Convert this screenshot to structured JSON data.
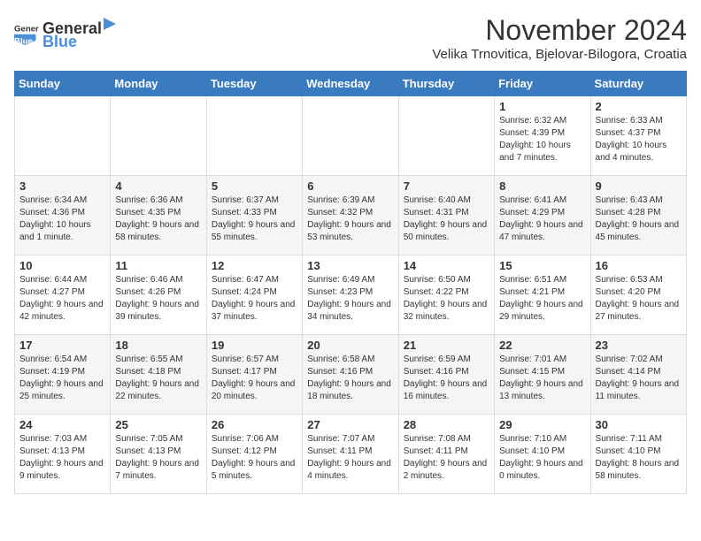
{
  "logo": {
    "general": "General",
    "blue": "Blue"
  },
  "title": "November 2024",
  "subtitle": "Velika Trnovitica, Bjelovar-Bilogora, Croatia",
  "days_of_week": [
    "Sunday",
    "Monday",
    "Tuesday",
    "Wednesday",
    "Thursday",
    "Friday",
    "Saturday"
  ],
  "weeks": [
    [
      {
        "day": "",
        "info": ""
      },
      {
        "day": "",
        "info": ""
      },
      {
        "day": "",
        "info": ""
      },
      {
        "day": "",
        "info": ""
      },
      {
        "day": "",
        "info": ""
      },
      {
        "day": "1",
        "info": "Sunrise: 6:32 AM\nSunset: 4:39 PM\nDaylight: 10 hours and 7 minutes."
      },
      {
        "day": "2",
        "info": "Sunrise: 6:33 AM\nSunset: 4:37 PM\nDaylight: 10 hours and 4 minutes."
      }
    ],
    [
      {
        "day": "3",
        "info": "Sunrise: 6:34 AM\nSunset: 4:36 PM\nDaylight: 10 hours and 1 minute."
      },
      {
        "day": "4",
        "info": "Sunrise: 6:36 AM\nSunset: 4:35 PM\nDaylight: 9 hours and 58 minutes."
      },
      {
        "day": "5",
        "info": "Sunrise: 6:37 AM\nSunset: 4:33 PM\nDaylight: 9 hours and 55 minutes."
      },
      {
        "day": "6",
        "info": "Sunrise: 6:39 AM\nSunset: 4:32 PM\nDaylight: 9 hours and 53 minutes."
      },
      {
        "day": "7",
        "info": "Sunrise: 6:40 AM\nSunset: 4:31 PM\nDaylight: 9 hours and 50 minutes."
      },
      {
        "day": "8",
        "info": "Sunrise: 6:41 AM\nSunset: 4:29 PM\nDaylight: 9 hours and 47 minutes."
      },
      {
        "day": "9",
        "info": "Sunrise: 6:43 AM\nSunset: 4:28 PM\nDaylight: 9 hours and 45 minutes."
      }
    ],
    [
      {
        "day": "10",
        "info": "Sunrise: 6:44 AM\nSunset: 4:27 PM\nDaylight: 9 hours and 42 minutes."
      },
      {
        "day": "11",
        "info": "Sunrise: 6:46 AM\nSunset: 4:26 PM\nDaylight: 9 hours and 39 minutes."
      },
      {
        "day": "12",
        "info": "Sunrise: 6:47 AM\nSunset: 4:24 PM\nDaylight: 9 hours and 37 minutes."
      },
      {
        "day": "13",
        "info": "Sunrise: 6:49 AM\nSunset: 4:23 PM\nDaylight: 9 hours and 34 minutes."
      },
      {
        "day": "14",
        "info": "Sunrise: 6:50 AM\nSunset: 4:22 PM\nDaylight: 9 hours and 32 minutes."
      },
      {
        "day": "15",
        "info": "Sunrise: 6:51 AM\nSunset: 4:21 PM\nDaylight: 9 hours and 29 minutes."
      },
      {
        "day": "16",
        "info": "Sunrise: 6:53 AM\nSunset: 4:20 PM\nDaylight: 9 hours and 27 minutes."
      }
    ],
    [
      {
        "day": "17",
        "info": "Sunrise: 6:54 AM\nSunset: 4:19 PM\nDaylight: 9 hours and 25 minutes."
      },
      {
        "day": "18",
        "info": "Sunrise: 6:55 AM\nSunset: 4:18 PM\nDaylight: 9 hours and 22 minutes."
      },
      {
        "day": "19",
        "info": "Sunrise: 6:57 AM\nSunset: 4:17 PM\nDaylight: 9 hours and 20 minutes."
      },
      {
        "day": "20",
        "info": "Sunrise: 6:58 AM\nSunset: 4:16 PM\nDaylight: 9 hours and 18 minutes."
      },
      {
        "day": "21",
        "info": "Sunrise: 6:59 AM\nSunset: 4:16 PM\nDaylight: 9 hours and 16 minutes."
      },
      {
        "day": "22",
        "info": "Sunrise: 7:01 AM\nSunset: 4:15 PM\nDaylight: 9 hours and 13 minutes."
      },
      {
        "day": "23",
        "info": "Sunrise: 7:02 AM\nSunset: 4:14 PM\nDaylight: 9 hours and 11 minutes."
      }
    ],
    [
      {
        "day": "24",
        "info": "Sunrise: 7:03 AM\nSunset: 4:13 PM\nDaylight: 9 hours and 9 minutes."
      },
      {
        "day": "25",
        "info": "Sunrise: 7:05 AM\nSunset: 4:13 PM\nDaylight: 9 hours and 7 minutes."
      },
      {
        "day": "26",
        "info": "Sunrise: 7:06 AM\nSunset: 4:12 PM\nDaylight: 9 hours and 5 minutes."
      },
      {
        "day": "27",
        "info": "Sunrise: 7:07 AM\nSunset: 4:11 PM\nDaylight: 9 hours and 4 minutes."
      },
      {
        "day": "28",
        "info": "Sunrise: 7:08 AM\nSunset: 4:11 PM\nDaylight: 9 hours and 2 minutes."
      },
      {
        "day": "29",
        "info": "Sunrise: 7:10 AM\nSunset: 4:10 PM\nDaylight: 9 hours and 0 minutes."
      },
      {
        "day": "30",
        "info": "Sunrise: 7:11 AM\nSunset: 4:10 PM\nDaylight: 8 hours and 58 minutes."
      }
    ]
  ]
}
